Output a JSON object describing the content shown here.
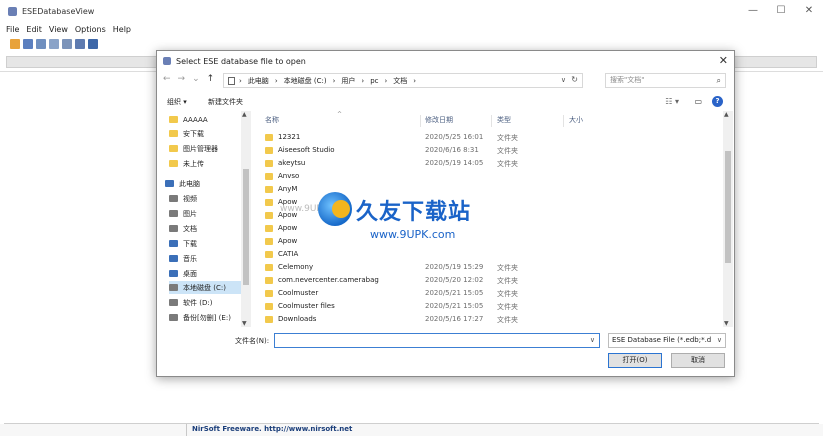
{
  "app": {
    "title": "ESEDatabaseView",
    "menu": [
      "File",
      "Edit",
      "View",
      "Options",
      "Help"
    ],
    "toolbar_icons": [
      "open-icon",
      "save-icon",
      "html-icon",
      "copy-icon",
      "properties-icon",
      "options-icon",
      "exit-icon"
    ],
    "window_controls": [
      "—",
      "☐",
      "✕"
    ],
    "status": "NirSoft Freeware.  http://www.nirsoft.net"
  },
  "dialog": {
    "title": "Select ESE database file to open",
    "close": "✕",
    "nav": {
      "back": "←",
      "forward": "→",
      "recent": "⌄",
      "up": "↑"
    },
    "breadcrumb": [
      "此电脑",
      "本地磁盘 (C:)",
      "用户",
      "pc",
      "文档"
    ],
    "search_placeholder": "搜索\"文档\"",
    "organize": "组织 ▾",
    "new_folder": "新建文件夹",
    "columns": {
      "name": "名称",
      "date": "修改日期",
      "type": "类型",
      "size": "大小"
    },
    "nav_items": [
      {
        "label": "AAAAA",
        "kind": "folder"
      },
      {
        "label": "安下载",
        "kind": "folder"
      },
      {
        "label": "图片管理器",
        "kind": "folder"
      },
      {
        "label": "未上传",
        "kind": "folder"
      },
      {
        "label": "此电脑",
        "kind": "pc"
      },
      {
        "label": "视频",
        "kind": "gray"
      },
      {
        "label": "图片",
        "kind": "gray"
      },
      {
        "label": "文档",
        "kind": "gray"
      },
      {
        "label": "下载",
        "kind": "pc"
      },
      {
        "label": "音乐",
        "kind": "pc"
      },
      {
        "label": "桌面",
        "kind": "pc"
      },
      {
        "label": "本地磁盘 (C:)",
        "kind": "gray",
        "selected": true
      },
      {
        "label": "软件 (D:)",
        "kind": "gray"
      },
      {
        "label": "备份[勿删] (E:)",
        "kind": "gray"
      }
    ],
    "files": [
      {
        "name": "12321",
        "date": "2020/5/25 16:01",
        "type": "文件夹"
      },
      {
        "name": "Aiseesoft Studio",
        "date": "2020/6/16 8:31",
        "type": "文件夹"
      },
      {
        "name": "akeytsu",
        "date": "2020/5/19 14:05",
        "type": "文件夹"
      },
      {
        "name": "Anvso",
        "date": "",
        "type": ""
      },
      {
        "name": "AnyM",
        "date": "",
        "type": ""
      },
      {
        "name": "Apow",
        "date": "",
        "type": ""
      },
      {
        "name": "Apow",
        "date": "",
        "type": ""
      },
      {
        "name": "Apow",
        "date": "",
        "type": ""
      },
      {
        "name": "Apow",
        "date": "",
        "type": ""
      },
      {
        "name": "CATIA",
        "date": "",
        "type": ""
      },
      {
        "name": "Celemony",
        "date": "2020/5/19 15:29",
        "type": "文件夹"
      },
      {
        "name": "com.nevercenter.camerabag",
        "date": "2020/5/20 12:02",
        "type": "文件夹"
      },
      {
        "name": "Coolmuster",
        "date": "2020/5/21 15:05",
        "type": "文件夹"
      },
      {
        "name": "Coolmuster files",
        "date": "2020/5/21 15:05",
        "type": "文件夹"
      },
      {
        "name": "Downloads",
        "date": "2020/5/16 17:27",
        "type": "文件夹"
      }
    ],
    "filename_label": "文件名(N):",
    "filename_value": "",
    "filter": "ESE Database File (*.edb;*.d",
    "open_button": "打开(O)",
    "cancel_button": "取消"
  },
  "watermark": {
    "cn": "久友下载站",
    "url": "www.9UPK.com",
    "ghost": "www.9UPK.com"
  },
  "colors": {
    "accent": "#2a63c8",
    "folder": "#f2c94c",
    "status_text": "#1b3e7a"
  }
}
